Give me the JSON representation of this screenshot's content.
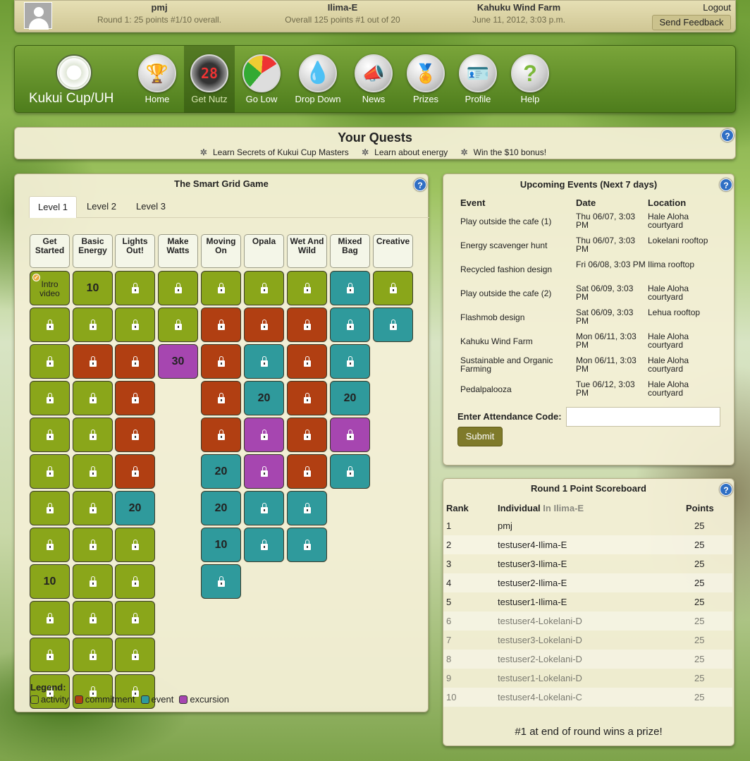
{
  "topbar": {
    "user": "pmj",
    "user_status": "Round 1: 25 points #1/10 overall.",
    "team": "Ilima-E",
    "team_status": "Overall 125 points #1 out of 20",
    "event_title": "Kahuku Wind Farm",
    "event_date": "June 11, 2012, 3:03 p.m.",
    "logout": "Logout",
    "feedback": "Send Feedback"
  },
  "nav": {
    "brand": "Kukui Cup/UH",
    "items": [
      {
        "label": "Home",
        "icon": "trophy-icon"
      },
      {
        "label": "Get Nutz",
        "icon": "scoreboard-icon"
      },
      {
        "label": "Go Low",
        "icon": "gauge-icon"
      },
      {
        "label": "Drop Down",
        "icon": "water-drop-icon"
      },
      {
        "label": "News",
        "icon": "megaphone-icon"
      },
      {
        "label": "Prizes",
        "icon": "medal-icon"
      },
      {
        "label": "Profile",
        "icon": "profile-card-icon"
      },
      {
        "label": "Help",
        "icon": "question-icon"
      }
    ]
  },
  "quests": {
    "title": "Your Quests",
    "items": [
      "Learn Secrets of Kukui Cup Masters",
      "Learn about energy",
      "Win the $10 bonus!"
    ]
  },
  "grid": {
    "title": "The Smart Grid Game",
    "tabs": [
      "Level 1",
      "Level 2",
      "Level 3"
    ],
    "columns": [
      "Get Started",
      "Basic Energy",
      "Lights Out!",
      "Make Watts",
      "Moving On",
      "Opala",
      "Wet And Wild",
      "Mixed Bag",
      "Creative"
    ],
    "cells": [
      [
        "a:Intro video",
        "a:",
        "a:",
        "a:",
        "a:",
        "a:",
        "a:",
        "a:",
        "a:10",
        "a:",
        "a:",
        "a:"
      ],
      [
        "a:10",
        "a:",
        "c:",
        "a:",
        "a:",
        "a:",
        "a:",
        "a:",
        "a:",
        "a:",
        "a:",
        "a:"
      ],
      [
        "a:",
        "a:",
        "c:",
        "c:",
        "c:",
        "c:",
        "e:20",
        "a:",
        "a:",
        "a:",
        "a:",
        "a:"
      ],
      [
        "a:",
        "a:",
        "x:30"
      ],
      [
        "a:",
        "c:",
        "c:",
        "c:",
        "c:",
        "e:20",
        "e:20",
        "e:10",
        "e:"
      ],
      [
        "a:",
        "c:",
        "e:",
        "e:20",
        "x:",
        "x:",
        "e:",
        "e:"
      ],
      [
        "a:",
        "c:",
        "c:",
        "c:",
        "c:",
        "c:",
        "e:",
        "e:"
      ],
      [
        "e:",
        "e:",
        "e:",
        "e:20",
        "x:",
        "e:"
      ],
      [
        "a:",
        "e:"
      ]
    ],
    "legend": {
      "title": "Legend:",
      "items": [
        {
          "label": "activity",
          "color": "#8aa61a"
        },
        {
          "label": "commitment",
          "color": "#b13f12"
        },
        {
          "label": "event",
          "color": "#2f9a9c"
        },
        {
          "label": "excursion",
          "color": "#a646b0"
        }
      ]
    }
  },
  "events": {
    "title": "Upcoming Events (Next 7 days)",
    "headers": [
      "Event",
      "Date",
      "Location"
    ],
    "rows": [
      [
        "Play outside the cafe (1)",
        "Thu 06/07, 3:03 PM",
        "Hale Aloha courtyard"
      ],
      [
        "Energy scavenger hunt",
        "Thu 06/07, 3:03 PM",
        "Lokelani rooftop"
      ],
      [
        "Recycled fashion design",
        "Fri 06/08, 3:03 PM",
        "Ilima rooftop"
      ],
      [
        "Play outside the cafe (2)",
        "Sat 06/09, 3:03 PM",
        "Hale Aloha courtyard"
      ],
      [
        "Flashmob design",
        "Sat 06/09, 3:03 PM",
        "Lehua rooftop"
      ],
      [
        "Kahuku Wind Farm",
        "Mon 06/11, 3:03 PM",
        "Hale Aloha courtyard"
      ],
      [
        "Sustainable and Organic Farming",
        "Mon 06/11, 3:03 PM",
        "Hale Aloha courtyard"
      ],
      [
        "Pedalpalooza",
        "Tue 06/12, 3:03 PM",
        "Hale Aloha courtyard"
      ]
    ],
    "code_label": "Enter Attendance Code:",
    "submit": "Submit"
  },
  "scoreboard": {
    "title": "Round 1 Point Scoreboard",
    "rank": "Rank",
    "individual": "Individual",
    "in_team": "In Ilima-E",
    "points": "Points",
    "rows": [
      [
        "1",
        "pmj",
        "25"
      ],
      [
        "2",
        "testuser4-Ilima-E",
        "25"
      ],
      [
        "3",
        "testuser3-Ilima-E",
        "25"
      ],
      [
        "4",
        "testuser2-Ilima-E",
        "25"
      ],
      [
        "5",
        "testuser1-Ilima-E",
        "25"
      ],
      [
        "6",
        "testuser4-Lokelani-D",
        "25"
      ],
      [
        "7",
        "testuser3-Lokelani-D",
        "25"
      ],
      [
        "8",
        "testuser2-Lokelani-D",
        "25"
      ],
      [
        "9",
        "testuser1-Lokelani-D",
        "25"
      ],
      [
        "10",
        "testuser4-Lokelani-C",
        "25"
      ]
    ],
    "prize": "#1 at end of round wins a prize!"
  }
}
